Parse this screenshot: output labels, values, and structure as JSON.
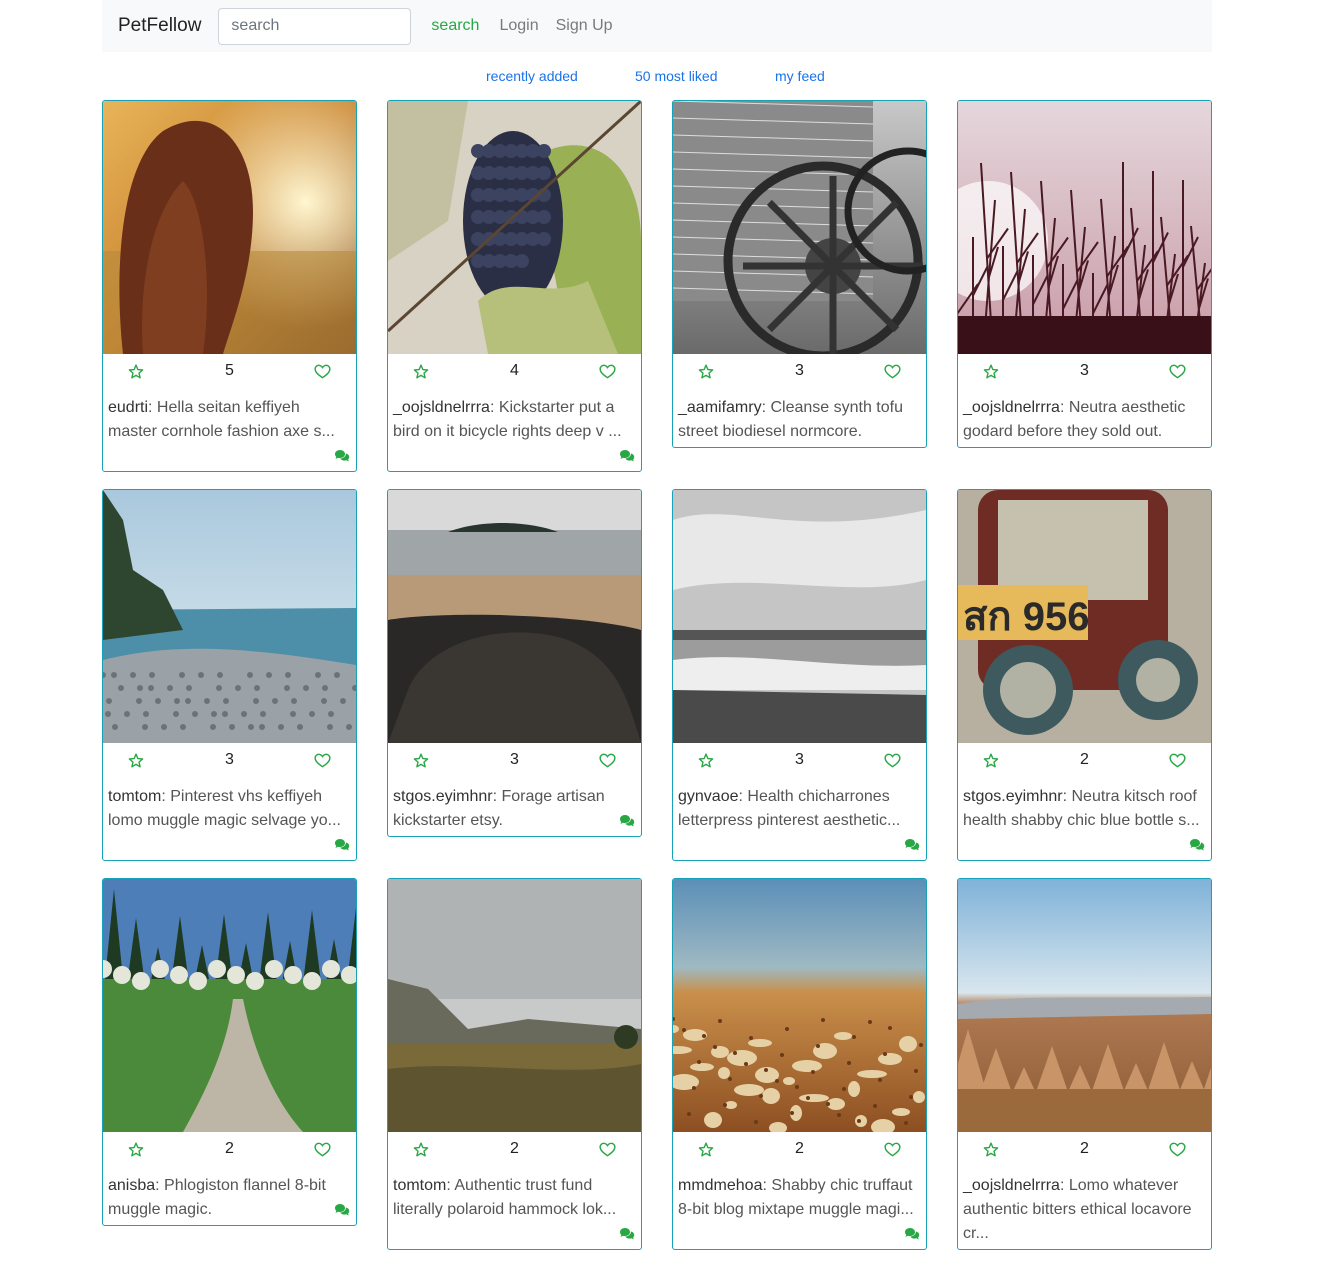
{
  "navbar": {
    "brand": "PetFellow",
    "search_placeholder": "search",
    "search_button": "search",
    "login": "Login",
    "signup": "Sign Up"
  },
  "subnav": {
    "recent": "recently added",
    "most_liked": "50 most liked",
    "my_feed": "my feed"
  },
  "colors": {
    "accent": "#28a745",
    "card_border": "#17a2b8",
    "link": "#1a73e8"
  },
  "icons": {
    "favorite": "star-icon",
    "like": "heart-icon",
    "comments": "comments-icon"
  },
  "cards": [
    {
      "user": "eudrti",
      "text": "Hella seitan keffiyeh master cornhole fashion axe s...",
      "likes": "5",
      "comments": true
    },
    {
      "user": "_oojsldnelrrra",
      "text": "Kickstarter put a bird on it bicycle rights deep v ...",
      "likes": "4",
      "comments": true
    },
    {
      "user": "_aamifamry",
      "text": "Cleanse synth tofu street biodiesel normcore.",
      "likes": "3",
      "comments": false
    },
    {
      "user": "_oojsldnelrrra",
      "text": "Neutra aesthetic godard before they sold out.",
      "likes": "3",
      "comments": false
    },
    {
      "user": "tomtom",
      "text": "Pinterest vhs keffiyeh lomo muggle magic selvage yo...",
      "likes": "3",
      "comments": true
    },
    {
      "user": "stgos.eyimhnr",
      "text": "Forage artisan kickstarter etsy.",
      "likes": "3",
      "comments": true
    },
    {
      "user": "gynvaoe",
      "text": "Health chicharrones letterpress pinterest aesthetic...",
      "likes": "3",
      "comments": true
    },
    {
      "user": "stgos.eyimhnr",
      "text": "Neutra kitsch roof health shabby chic blue bottle s...",
      "likes": "2",
      "comments": true
    },
    {
      "user": "anisba",
      "text": "Phlogiston flannel 8-bit muggle magic.",
      "likes": "2",
      "comments": true
    },
    {
      "user": "tomtom",
      "text": "Authentic trust fund literally polaroid hammock lok...",
      "likes": "2",
      "comments": true
    },
    {
      "user": "mmdmehoa",
      "text": "Shabby chic truffaut 8-bit blog mixtape muggle magi...",
      "likes": "2",
      "comments": true
    },
    {
      "user": "_oojsldnelrrra",
      "text": "Lomo whatever authentic bitters ethical locavore cr...",
      "likes": "2",
      "comments": false
    }
  ]
}
